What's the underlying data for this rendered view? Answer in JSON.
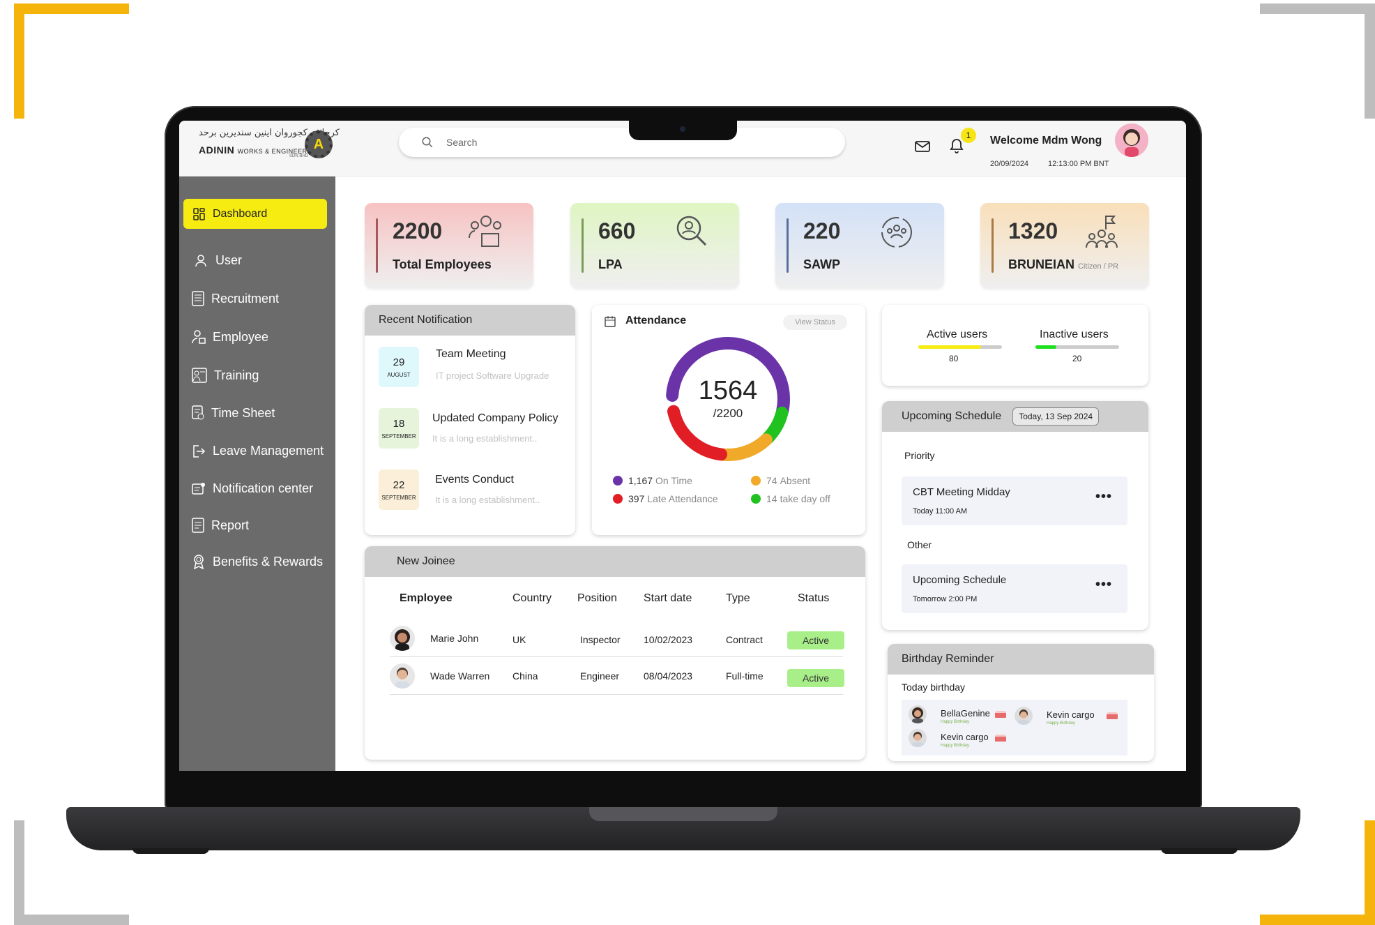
{
  "colors": {
    "accent_yellow": "#f7ec12",
    "frame_yellow": "#f5b40c",
    "sidebar": "#6b6b6b",
    "active_green": "#a8ef8a"
  },
  "header": {
    "logo_arabic": "كرجا٢ن كجوروان اينين سنديرين برحد",
    "logo_name": "ADININ",
    "logo_sub": "WORKS & ENGINEERING",
    "logo_sdn": "SDN BHD",
    "logo_mark": "A",
    "search_placeholder": "Search",
    "notifications_count": "1",
    "welcome": "Welcome Mdm Wong",
    "date": "20/09/2024",
    "time": "12:13:00 PM BNT"
  },
  "sidebar": {
    "items": [
      {
        "label": "Dashboard",
        "icon": "grid-icon"
      },
      {
        "label": "User",
        "icon": "user-icon"
      },
      {
        "label": "Recruitment",
        "icon": "document-icon"
      },
      {
        "label": "Employee",
        "icon": "employee-icon"
      },
      {
        "label": "Training",
        "icon": "training-icon"
      },
      {
        "label": "Time Sheet",
        "icon": "timesheet-icon"
      },
      {
        "label": "Leave Management",
        "icon": "exit-icon"
      },
      {
        "label": "Notification center",
        "icon": "notification-icon"
      },
      {
        "label": "Report",
        "icon": "report-icon"
      },
      {
        "label": "Benefits & Rewards",
        "icon": "award-icon"
      }
    ]
  },
  "stats": [
    {
      "value": "2200",
      "label": "Total Employees",
      "note": "",
      "color": "#f7c2c2"
    },
    {
      "value": "660",
      "label": "LPA",
      "note": "",
      "color": "#dff5c2"
    },
    {
      "value": "220",
      "label": "SAWP",
      "note": "",
      "color": "#d3e1f7"
    },
    {
      "value": "1320",
      "label": "BRUNEIAN",
      "note": "Citizen / PR",
      "color": "#f9dfba"
    }
  ],
  "notifications": {
    "title": "Recent Notification",
    "items": [
      {
        "day": "29",
        "month": "AUGUST",
        "title": "Team Meeting",
        "sub": "IT project Software Upgrade",
        "color": "#dff8fc"
      },
      {
        "day": "18",
        "month": "SEPTEMBER",
        "title": "Updated Company Policy",
        "sub": "It is a long establishment..",
        "color": "#e6f4dc"
      },
      {
        "day": "22",
        "month": "SEPTEMBER",
        "title": "Events Conduct",
        "sub": "It is a long establishment..",
        "color": "#fcefd9"
      }
    ]
  },
  "attendance": {
    "title": "Attendance",
    "view_status": "View Status",
    "present": "1564",
    "total": "/2200",
    "legend": [
      {
        "value": "1,167",
        "label": "On Time",
        "color": "#6a33a8"
      },
      {
        "value": "74",
        "label": "Absent",
        "color": "#f0a928"
      },
      {
        "value": "397",
        "label": "Late Attendance",
        "color": "#e11e25"
      },
      {
        "value": "14",
        "label": "take day off",
        "color": "#1fc21f"
      }
    ],
    "segments": [
      {
        "name": "on-time",
        "fraction": 0.53,
        "color": "#6a33a8"
      },
      {
        "name": "take-day-off",
        "fraction": 0.09,
        "color": "#1fc21f"
      },
      {
        "name": "absent",
        "fraction": 0.14,
        "color": "#f0a928"
      },
      {
        "name": "late",
        "fraction": 0.2,
        "color": "#e11e25"
      }
    ]
  },
  "users": {
    "active_label": "Active users",
    "active_value": "80",
    "active_fraction": 0.75,
    "active_color": "#f7ec12",
    "inactive_label": "Inactive users",
    "inactive_value": "20",
    "inactive_fraction": 0.25,
    "inactive_color": "#1fe01f"
  },
  "joinee": {
    "title": "New Joinee",
    "columns": [
      "Employee",
      "Country",
      "Position",
      "Start date",
      "Type",
      "Status"
    ],
    "rows": [
      {
        "name": "Marie John",
        "country": "UK",
        "position": "Inspector",
        "start": "10/02/2023",
        "type": "Contract",
        "status": "Active"
      },
      {
        "name": "Wade Warren",
        "country": "China",
        "position": "Engineer",
        "start": "08/04/2023",
        "type": "Full-time",
        "status": "Active"
      }
    ]
  },
  "schedule": {
    "title": "Upcoming Schedule",
    "date_chip": "Today, 13 Sep 2024",
    "priority_label": "Priority",
    "other_label": "Other",
    "priority_item": {
      "title": "CBT Meeting Midday",
      "sub": "Today 11:00 AM"
    },
    "other_item": {
      "title": "Upcoming Schedule",
      "sub": "Tomorrow 2:00 PM"
    },
    "menu": "•••"
  },
  "birthday": {
    "title": "Birthday Reminder",
    "today_label": "Today birthday",
    "note": "Happy Birthday",
    "people": [
      "BellaGenine",
      "Kevin cargo",
      "Kevin cargo"
    ]
  }
}
